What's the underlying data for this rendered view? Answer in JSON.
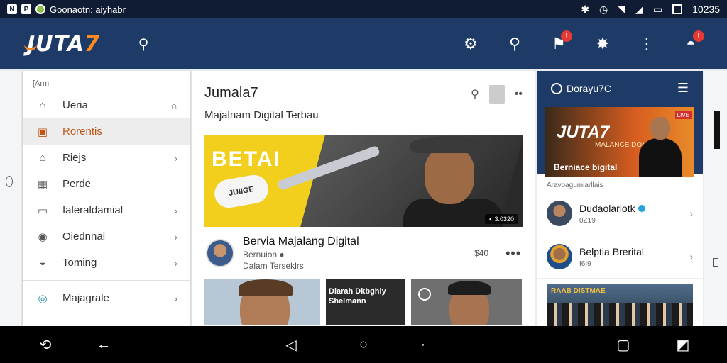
{
  "status_bar": {
    "notification_text": "Goonaotn: aiyhabr",
    "time": "10235",
    "icons": [
      "notification-icon",
      "app-icon",
      "bluetooth-icon",
      "alarm-icon",
      "wifi-icon",
      "signal-icon",
      "battery-icon"
    ]
  },
  "app_bar": {
    "logo_text": "JUTA",
    "logo_number": "7",
    "brand_color": "#1e3a66",
    "accent_color": "#ff8a1f",
    "notifications_badge": "!",
    "alerts_badge": "!"
  },
  "drawer": {
    "header": "[Arm",
    "items": [
      {
        "label": "Ueria",
        "icon": "home-icon",
        "trailing": "bookmark-icon"
      },
      {
        "label": "Rorentis",
        "icon": "news-icon",
        "active": true
      },
      {
        "label": "Riejs",
        "icon": "folder-icon",
        "trailing": "chevron-right-icon"
      },
      {
        "label": "Perde",
        "icon": "calendar-icon"
      },
      {
        "label": "Ialeraldamial",
        "icon": "document-icon",
        "trailing": "chevron-right-icon"
      },
      {
        "label": "Oiednnai",
        "icon": "info-icon",
        "trailing": "chevron-right-icon"
      },
      {
        "label": "Toming",
        "icon": "inbox-icon",
        "trailing": "chevron-right-icon"
      },
      {
        "label": "Majagrale",
        "icon": "compass-icon",
        "trailing": "chevron-right-icon"
      }
    ]
  },
  "feed": {
    "title": "Jumala7",
    "subtitle": "Majalnam Digital Terbau",
    "hero": {
      "text": "BETAI",
      "tag": "JUIIGE",
      "stamp": "3.0320"
    },
    "post": {
      "title": "Bervia Majalang Digital",
      "meta": "Bernuion",
      "meta2": "Dalam Terseklrs",
      "count": "$40"
    },
    "thumb_text": "Dlarah Dkbghly\nShelmann"
  },
  "right_panel": {
    "title": "Dorayu7C",
    "banner": {
      "logo": "JUTA7",
      "subtitle": "MALANCE DOMAN",
      "caption": "Berniace bigital",
      "tag": "LIVE"
    },
    "section_label": "Aravpagumiarllais",
    "items": [
      {
        "title": "Dudaolariotk",
        "subtitle": "0Z19",
        "verified": true
      },
      {
        "title": "Belptia Brerital",
        "subtitle": "I6I9",
        "verified": false
      }
    ],
    "photo_text": "RAAB DISTMAE"
  },
  "nav_bar": {
    "buttons": [
      "rotate-icon",
      "back-icon",
      "back-triangle-icon",
      "home-circle-icon",
      "dot-icon",
      "recents-icon",
      "screenshot-icon"
    ]
  }
}
